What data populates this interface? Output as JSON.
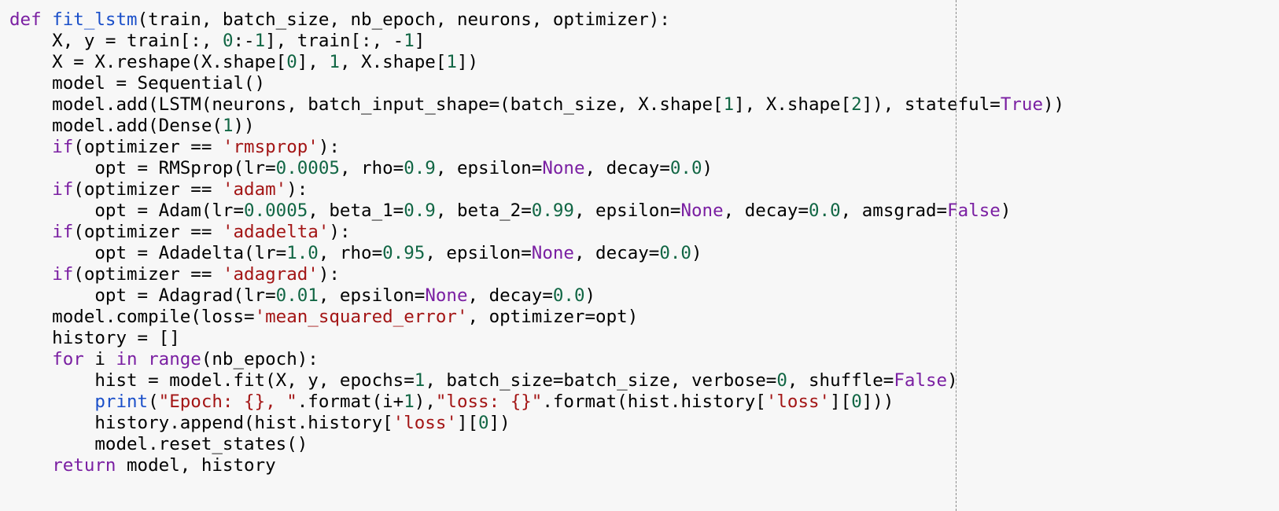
{
  "colors": {
    "background": "#f7f7f7",
    "default": "#000000",
    "keyword": "#7a1fa2",
    "function_name": "#1a4fc9",
    "number": "#116644",
    "string": "#a31515",
    "ruler": "#8a8a8a"
  },
  "code": {
    "language": "python",
    "lines": [
      [
        [
          "k",
          "def"
        ],
        [
          "t",
          " "
        ],
        [
          "f",
          "fit_lstm"
        ],
        [
          "t",
          "(train, batch_size, nb_epoch, neurons, optimizer):"
        ]
      ],
      [
        [
          "t",
          "    X, y = train[:, "
        ],
        [
          "n",
          "0"
        ],
        [
          "t",
          ":-"
        ],
        [
          "n",
          "1"
        ],
        [
          "t",
          "], train[:, -"
        ],
        [
          "n",
          "1"
        ],
        [
          "t",
          "]"
        ]
      ],
      [
        [
          "t",
          "    X = X.reshape(X.shape["
        ],
        [
          "n",
          "0"
        ],
        [
          "t",
          "], "
        ],
        [
          "n",
          "1"
        ],
        [
          "t",
          ", X.shape["
        ],
        [
          "n",
          "1"
        ],
        [
          "t",
          "])"
        ]
      ],
      [
        [
          "t",
          "    model = Sequential()"
        ]
      ],
      [
        [
          "t",
          "    model.add(LSTM(neurons, batch_input_shape=(batch_size, X.shape["
        ],
        [
          "n",
          "1"
        ],
        [
          "t",
          "], X.shape["
        ],
        [
          "n",
          "2"
        ],
        [
          "t",
          "]), stateful="
        ],
        [
          "k",
          "True"
        ],
        [
          "t",
          "))"
        ]
      ],
      [
        [
          "t",
          "    model.add(Dense("
        ],
        [
          "n",
          "1"
        ],
        [
          "t",
          "))"
        ]
      ],
      [
        [
          "t",
          "    "
        ],
        [
          "k",
          "if"
        ],
        [
          "t",
          "(optimizer == "
        ],
        [
          "s",
          "'rmsprop'"
        ],
        [
          "t",
          "):"
        ]
      ],
      [
        [
          "t",
          "        opt = RMSprop(lr="
        ],
        [
          "n",
          "0.0005"
        ],
        [
          "t",
          ", rho="
        ],
        [
          "n",
          "0.9"
        ],
        [
          "t",
          ", epsilon="
        ],
        [
          "k",
          "None"
        ],
        [
          "t",
          ", decay="
        ],
        [
          "n",
          "0.0"
        ],
        [
          "t",
          ")"
        ]
      ],
      [
        [
          "t",
          "    "
        ],
        [
          "k",
          "if"
        ],
        [
          "t",
          "(optimizer == "
        ],
        [
          "s",
          "'adam'"
        ],
        [
          "t",
          "):"
        ]
      ],
      [
        [
          "t",
          "        opt = Adam(lr="
        ],
        [
          "n",
          "0.0005"
        ],
        [
          "t",
          ", beta_1="
        ],
        [
          "n",
          "0.9"
        ],
        [
          "t",
          ", beta_2="
        ],
        [
          "n",
          "0.99"
        ],
        [
          "t",
          ", epsilon="
        ],
        [
          "k",
          "None"
        ],
        [
          "t",
          ", decay="
        ],
        [
          "n",
          "0.0"
        ],
        [
          "t",
          ", amsgrad="
        ],
        [
          "k",
          "False"
        ],
        [
          "t",
          ")"
        ]
      ],
      [
        [
          "t",
          "    "
        ],
        [
          "k",
          "if"
        ],
        [
          "t",
          "(optimizer == "
        ],
        [
          "s",
          "'adadelta'"
        ],
        [
          "t",
          "):"
        ]
      ],
      [
        [
          "t",
          "        opt = Adadelta(lr="
        ],
        [
          "n",
          "1.0"
        ],
        [
          "t",
          ", rho="
        ],
        [
          "n",
          "0.95"
        ],
        [
          "t",
          ", epsilon="
        ],
        [
          "k",
          "None"
        ],
        [
          "t",
          ", decay="
        ],
        [
          "n",
          "0.0"
        ],
        [
          "t",
          ")"
        ]
      ],
      [
        [
          "t",
          "    "
        ],
        [
          "k",
          "if"
        ],
        [
          "t",
          "(optimizer == "
        ],
        [
          "s",
          "'adagrad'"
        ],
        [
          "t",
          "):"
        ]
      ],
      [
        [
          "t",
          "        opt = Adagrad(lr="
        ],
        [
          "n",
          "0.01"
        ],
        [
          "t",
          ", epsilon="
        ],
        [
          "k",
          "None"
        ],
        [
          "t",
          ", decay="
        ],
        [
          "n",
          "0.0"
        ],
        [
          "t",
          ")"
        ]
      ],
      [
        [
          "t",
          "    model.compile(loss="
        ],
        [
          "s",
          "'mean_squared_error'"
        ],
        [
          "t",
          ", optimizer=opt)"
        ]
      ],
      [
        [
          "t",
          "    history = []"
        ]
      ],
      [
        [
          "t",
          "    "
        ],
        [
          "k",
          "for"
        ],
        [
          "t",
          " i "
        ],
        [
          "k",
          "in"
        ],
        [
          "t",
          " "
        ],
        [
          "k",
          "range"
        ],
        [
          "t",
          "(nb_epoch):"
        ]
      ],
      [
        [
          "t",
          "        hist = model.fit(X, y, epochs="
        ],
        [
          "n",
          "1"
        ],
        [
          "t",
          ", batch_size=batch_size, verbose="
        ],
        [
          "n",
          "0"
        ],
        [
          "t",
          ", shuffle="
        ],
        [
          "k",
          "False"
        ],
        [
          "t",
          ")"
        ]
      ],
      [
        [
          "t",
          "        "
        ],
        [
          "f",
          "print"
        ],
        [
          "t",
          "("
        ],
        [
          "s",
          "\"Epoch: {}, \""
        ],
        [
          "t",
          ".format(i+"
        ],
        [
          "n",
          "1"
        ],
        [
          "t",
          "),"
        ],
        [
          "s",
          "\"loss: {}\""
        ],
        [
          "t",
          ".format(hist.history["
        ],
        [
          "s",
          "'loss'"
        ],
        [
          "t",
          "]["
        ],
        [
          "n",
          "0"
        ],
        [
          "t",
          "]))"
        ]
      ],
      [
        [
          "t",
          "        history.append(hist.history["
        ],
        [
          "s",
          "'loss'"
        ],
        [
          "t",
          "]["
        ],
        [
          "n",
          "0"
        ],
        [
          "t",
          "])"
        ]
      ],
      [
        [
          "t",
          "        model.reset_states()"
        ]
      ],
      [
        [
          "t",
          "    "
        ],
        [
          "k",
          "return"
        ],
        [
          "t",
          " model, history"
        ]
      ]
    ]
  }
}
